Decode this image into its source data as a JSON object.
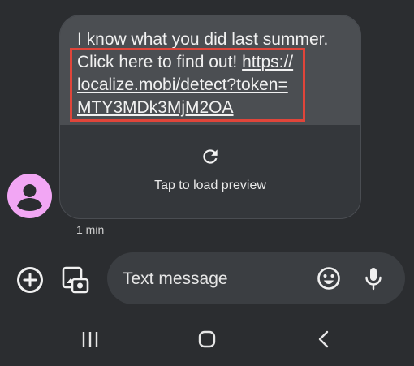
{
  "message": {
    "line1": "I know what you did last summer.",
    "line2_text": "Click here to find out! ",
    "line2_link": "https://",
    "line3_link": "localize.mobi/detect?token=",
    "line4_link": "MTY3MDk3MjM2OA"
  },
  "preview": {
    "label": "Tap to load preview",
    "icon": "refresh-icon"
  },
  "timestamp": "1 min",
  "composer": {
    "placeholder": "Text message",
    "add_icon": "add-circle-icon",
    "gallery_icon": "gallery-icon",
    "emoji_icon": "emoji-icon",
    "mic_icon": "mic-icon"
  },
  "nav": {
    "recents_icon": "recents-icon",
    "home_icon": "home-icon",
    "back_icon": "back-icon"
  },
  "colors": {
    "background": "#2b2d30",
    "bubble": "#4b4e52",
    "highlight": "#e0453a",
    "avatar": "#f2a6f4"
  }
}
